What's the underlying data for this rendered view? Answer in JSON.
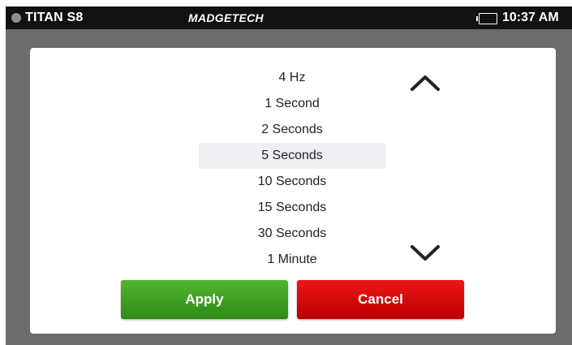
{
  "status_bar": {
    "device_name": "TITAN S8",
    "brand": "MADGETECH",
    "time": "10:37 AM",
    "battery_icon": "battery-icon",
    "battery_color": "#3ccf3c"
  },
  "picker": {
    "options": [
      "4 Hz",
      "1 Second",
      "2 Seconds",
      "5 Seconds",
      "10 Seconds",
      "15 Seconds",
      "30 Seconds",
      "1 Minute"
    ],
    "selected": "5 Seconds",
    "scroll_up_icon": "chevron-up-icon",
    "scroll_down_icon": "chevron-down-icon"
  },
  "buttons": {
    "apply_label": "Apply",
    "cancel_label": "Cancel",
    "apply_color": "#3a9a1f",
    "cancel_color": "#d40808"
  }
}
